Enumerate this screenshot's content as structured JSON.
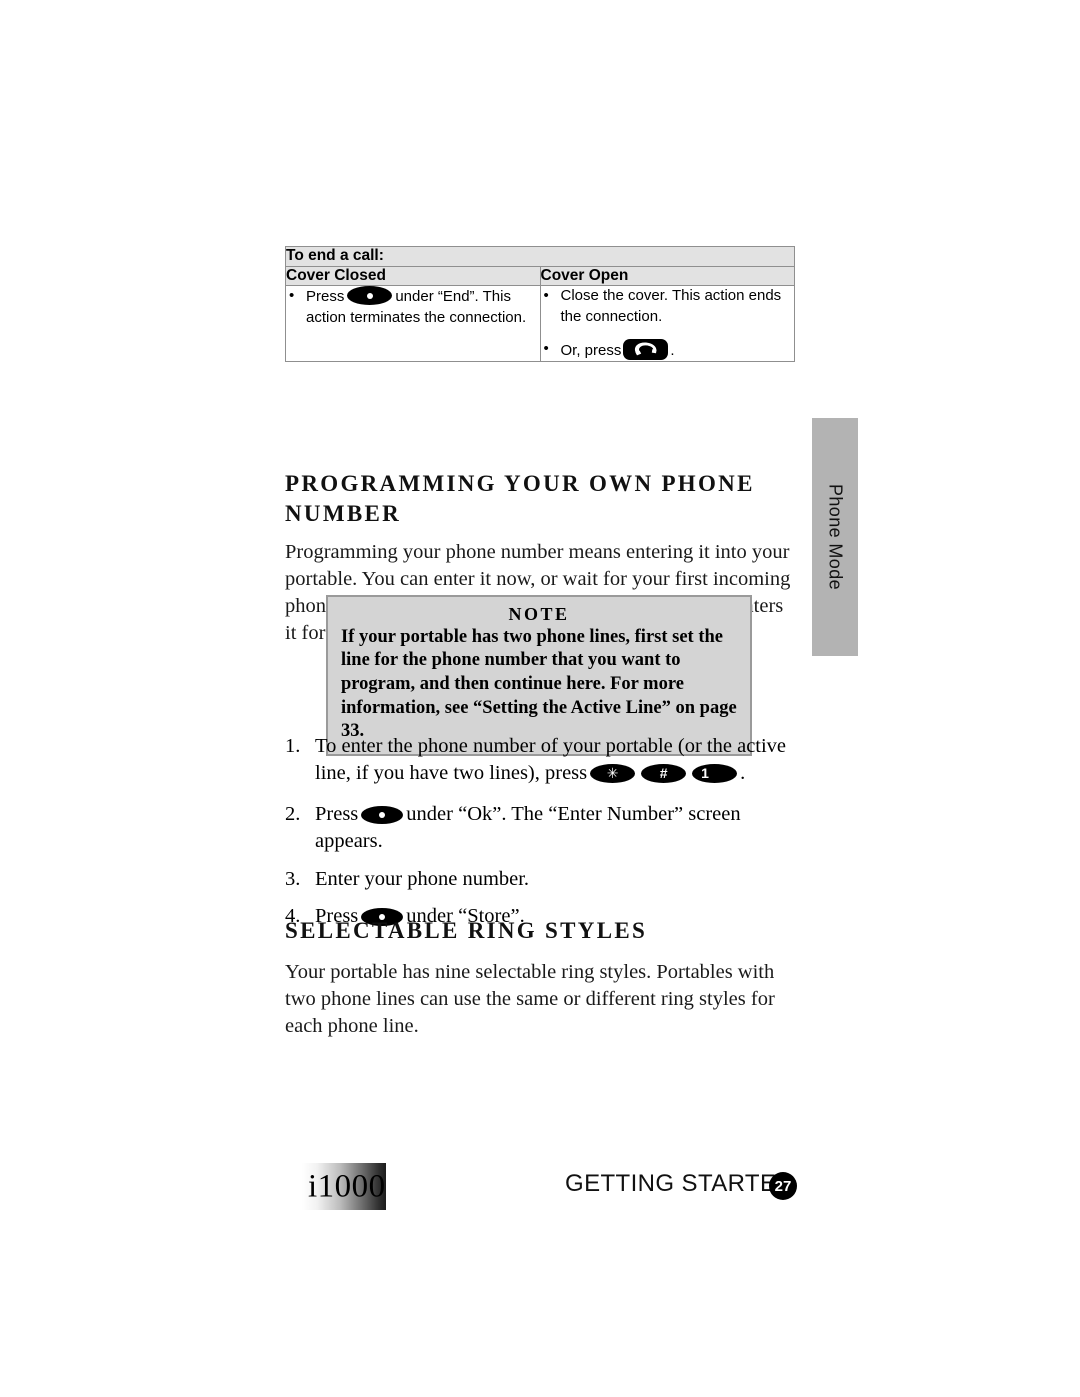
{
  "side_tab": {
    "label": "Phone Mode",
    "background_color": "#b3b3b3"
  },
  "table": {
    "title": "To end a call:",
    "columns": [
      "Cover Closed",
      "Cover Open"
    ],
    "cover_closed": {
      "bullets": [
        {
          "before": "Press",
          "key": "softkey-ellipse",
          "after": "under “End”. This action terminates the connection."
        }
      ]
    },
    "cover_open": {
      "bullets": [
        {
          "text": "Close the cover. This action ends the connection."
        },
        {
          "before": "Or, press",
          "key": "hangup-key",
          "after": "."
        }
      ]
    }
  },
  "section_programming": {
    "title": "PROGRAMMING YOUR OWN PHONE NUMBER",
    "paragraph": "Programming your phone number means entering it into your portable. You can enter it now, or wait for your first incoming phone call, when your carrier’s network automatically enters it for you."
  },
  "note": {
    "title": "NOTE",
    "body": "If your portable has two phone lines, first set the line for the phone number that you want to program, and then continue here. For more information, see “Setting the Active Line” on page 33.",
    "background_color": "#d4d4d4",
    "border_color": "#9a9a9a"
  },
  "steps": [
    {
      "number": "1.",
      "before": "To enter the phone number of your portable (or the active line, if you have two lines), press",
      "keys": [
        "star-key",
        "pound-key",
        "one-key"
      ],
      "after": "."
    },
    {
      "number": "2.",
      "before": "Press",
      "keys": [
        "softkey-ellipse"
      ],
      "after": "under “Ok”. The “Enter Number” screen appears."
    },
    {
      "number": "3.",
      "before": "Enter your phone number.",
      "keys": [],
      "after": ""
    },
    {
      "number": "4.",
      "before": "Press",
      "keys": [
        "softkey-ellipse"
      ],
      "after": "under “Store”."
    }
  ],
  "key_glyphs": {
    "star": "✳",
    "pound": "#",
    "one": "1"
  },
  "section_ring": {
    "title": "SELECTABLE RING STYLES",
    "paragraph": "Your portable has nine selectable ring styles. Portables with two phone lines can use the same or different ring styles for each phone line."
  },
  "footer": {
    "logo_text": "i1000",
    "title": "GETTING STARTED",
    "page_number": "27"
  }
}
